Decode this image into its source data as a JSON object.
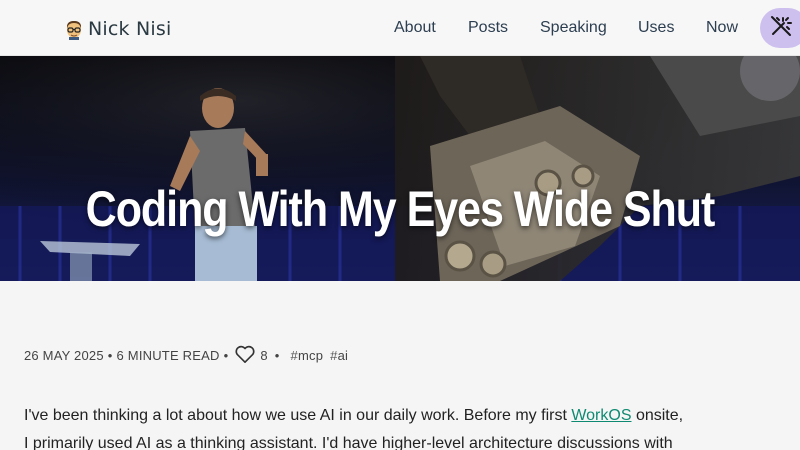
{
  "header": {
    "brand": {
      "emoji_icon": "nerd-face-icon",
      "name": "Nick Nisi"
    },
    "nav": [
      {
        "label": "About"
      },
      {
        "label": "Posts"
      },
      {
        "label": "Speaking"
      },
      {
        "label": "Uses"
      },
      {
        "label": "Now"
      }
    ],
    "theme_toggle_icon": "magic-wand-off-icon",
    "colors": {
      "toggle_bg": "#cdbfee",
      "nav_text": "#2c3e50"
    }
  },
  "hero": {
    "title": "Coding With My Eyes Wide Shut"
  },
  "post_meta": {
    "date": "26 MAY 2025",
    "read_time": "6 MINUTE READ",
    "separator": "•",
    "like_icon": "heart-icon",
    "like_count": "8",
    "tags": [
      {
        "hash": "#",
        "label": "mcp"
      },
      {
        "hash": "#",
        "label": "ai"
      }
    ]
  },
  "content": {
    "line1_before": "I've been thinking a lot about how we use AI in our daily work. Before my first ",
    "link_text": "WorkOS",
    "line1_after": " onsite,",
    "line2": "I primarily used AI as a thinking assistant. I'd have higher-level architecture discussions with",
    "link_color": "#0f8a72"
  }
}
